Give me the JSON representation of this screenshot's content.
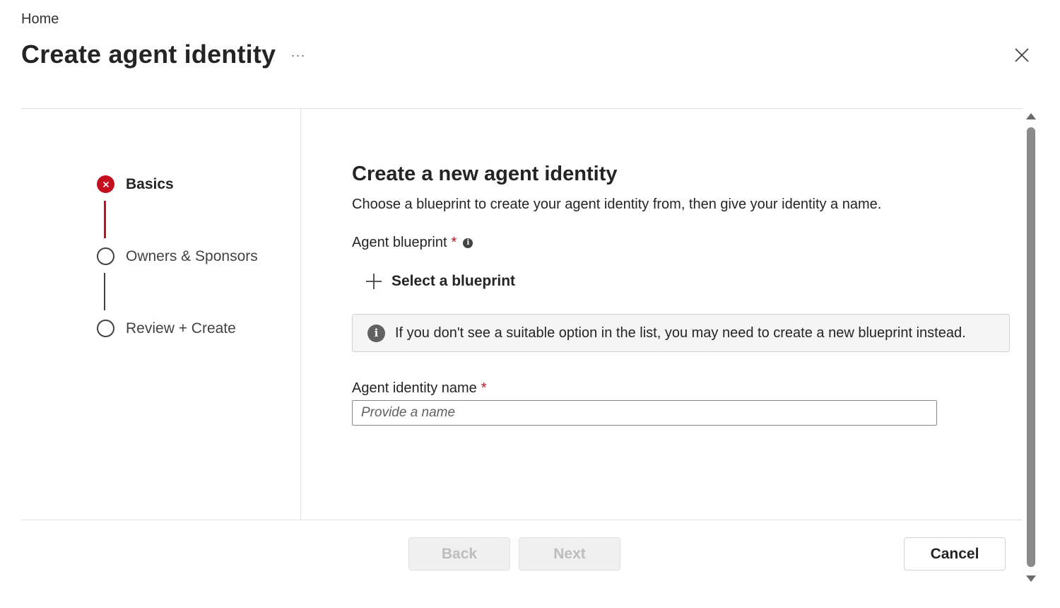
{
  "header": {
    "breadcrumb": "Home",
    "title": "Create agent identity",
    "more_label": "···"
  },
  "steps": [
    {
      "label": "Basics",
      "state": "error"
    },
    {
      "label": "Owners & Sponsors",
      "state": "pending"
    },
    {
      "label": "Review + Create",
      "state": "pending"
    }
  ],
  "main": {
    "section_title": "Create a new agent identity",
    "section_description": "Choose a blueprint to create your agent identity from, then give your identity a name.",
    "blueprint": {
      "label": "Agent blueprint",
      "required_marker": "*",
      "info_icon": "info-icon",
      "select_label": "Select a blueprint"
    },
    "info_bar": {
      "icon": "info-icon",
      "message": "If you don't see a suitable option in the list, you may need to create a new blueprint instead."
    },
    "name_field": {
      "label": "Agent identity name",
      "required_marker": "*",
      "value": "",
      "placeholder": "Provide a name"
    }
  },
  "footer": {
    "back_label": "Back",
    "next_label": "Next",
    "cancel_label": "Cancel"
  },
  "colors": {
    "error": "#c50f1f",
    "text": "#242424",
    "border": "#e1dfdd"
  }
}
